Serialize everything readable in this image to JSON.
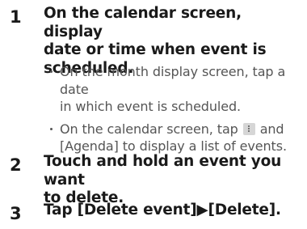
{
  "steps": [
    {
      "number": "1",
      "title_lines": [
        "On the calendar screen, display",
        "date or time when event is",
        "scheduled."
      ],
      "bullets": [
        {
          "lines": [
            "On the month display screen, tap a date",
            "in which event is scheduled."
          ]
        },
        {
          "line1_before_icon": "On the calendar screen, tap ",
          "line1_after_icon": " and",
          "line2": "[Agenda] to display a list of events.",
          "icon": "menu-dots-icon"
        }
      ]
    },
    {
      "number": "2",
      "title_lines": [
        "Touch and hold an event you want",
        "to delete."
      ]
    },
    {
      "number": "3",
      "title_lines": [
        "Tap [Delete event]▶[Delete]."
      ]
    }
  ]
}
